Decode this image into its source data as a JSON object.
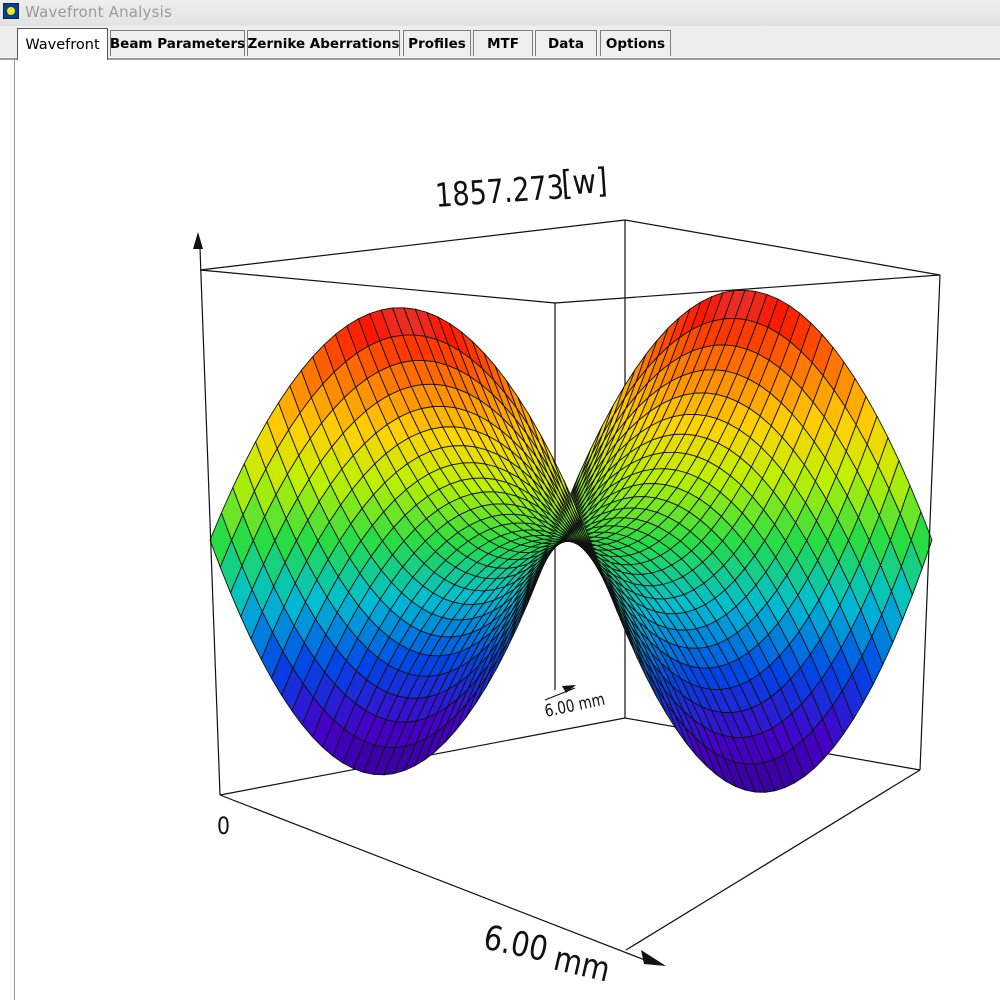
{
  "window": {
    "title": "Wavefront Analysis",
    "icon": "app-icon"
  },
  "tabs": [
    {
      "label": "Wavefront",
      "active": true
    },
    {
      "label": "Beam Parameters",
      "active": false
    },
    {
      "label": "Zernike Aberrations",
      "active": false
    },
    {
      "label": "Profiles",
      "active": false
    },
    {
      "label": "MTF",
      "active": false
    },
    {
      "label": "Data",
      "active": false
    },
    {
      "label": "Options",
      "active": false
    }
  ],
  "plot": {
    "peak_value": "1857.273",
    "peak_unit": "[w]",
    "axis_origin_label": "0",
    "x_axis_value": "6.00",
    "x_axis_unit": "mm",
    "y_axis_label": "6.00 mm",
    "colors": {
      "high": "#ff0000",
      "mid": "#ffff00",
      "low": "#3b00a8",
      "mesh": "#000000"
    }
  }
}
